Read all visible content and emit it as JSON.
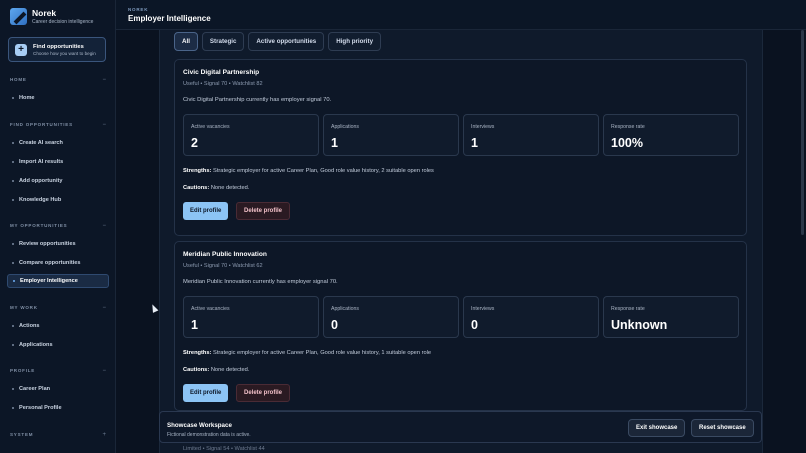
{
  "brand": {
    "name": "Norek",
    "subtitle": "Career decision intelligence"
  },
  "find_button": {
    "title": "Find opportunities",
    "subtitle": "Choose how you want to begin"
  },
  "sidebar": {
    "home": {
      "heading": "HOME",
      "chevron": "−",
      "items": [
        "Home"
      ]
    },
    "find": {
      "heading": "FIND OPPORTUNITIES",
      "chevron": "−",
      "items": [
        "Create AI search",
        "Import AI results",
        "Add opportunity",
        "Knowledge Hub"
      ]
    },
    "mine": {
      "heading": "MY OPPORTUNITIES",
      "chevron": "−",
      "items": [
        "Review opportunities",
        "Compare opportunities",
        "Employer Intelligence"
      ]
    },
    "work": {
      "heading": "MY WORK",
      "chevron": "−",
      "items": [
        "Actions",
        "Applications"
      ]
    },
    "profile": {
      "heading": "PROFILE",
      "chevron": "−",
      "items": [
        "Career Plan",
        "Personal Profile"
      ]
    },
    "system": {
      "heading": "SYSTEM",
      "chevron": "+"
    },
    "active_item": "Employer Intelligence"
  },
  "header": {
    "eyebrow": "NOREK",
    "title": "Employer Intelligence"
  },
  "filters": [
    "All",
    "Strategic",
    "Active opportunities",
    "High priority"
  ],
  "active_filter": "All",
  "cards": [
    {
      "title": "Civic Digital Partnership",
      "meta": "Useful • Signal 70 • Watchlist 82",
      "description": "Civic Digital Partnership currently has employer signal 70.",
      "stats": [
        {
          "label": "Active vacancies",
          "value": "2"
        },
        {
          "label": "Applications",
          "value": "1"
        },
        {
          "label": "Interviews",
          "value": "1"
        },
        {
          "label": "Response rate",
          "value": "100%"
        }
      ],
      "strengths_label": "Strengths:",
      "strengths": "Strategic employer for active Career Plan, Good role value history, 2 suitable open roles",
      "cautions_label": "Cautions:",
      "cautions": "None detected.",
      "edit_label": "Edit profile",
      "delete_label": "Delete profile"
    },
    {
      "title": "Meridian Public Innovation",
      "meta": "Useful • Signal 70 • Watchlist 62",
      "description": "Meridian Public Innovation currently has employer signal 70.",
      "stats": [
        {
          "label": "Active vacancies",
          "value": "1"
        },
        {
          "label": "Applications",
          "value": "0"
        },
        {
          "label": "Interviews",
          "value": "0"
        },
        {
          "label": "Response rate",
          "value": "Unknown"
        }
      ],
      "strengths_label": "Strengths:",
      "strengths": "Strategic employer for active Career Plan, Good role value history, 1 suitable open role",
      "cautions_label": "Cautions:",
      "cautions": "None detected.",
      "edit_label": "Edit profile",
      "delete_label": "Delete profile"
    }
  ],
  "peek_meta": "Limited • Signal 54 • Watchlist 44",
  "showcase": {
    "title": "Showcase Workspace",
    "subtitle": "Fictional demonstration data is active.",
    "exit_label": "Exit showcase",
    "reset_label": "Reset showcase"
  }
}
